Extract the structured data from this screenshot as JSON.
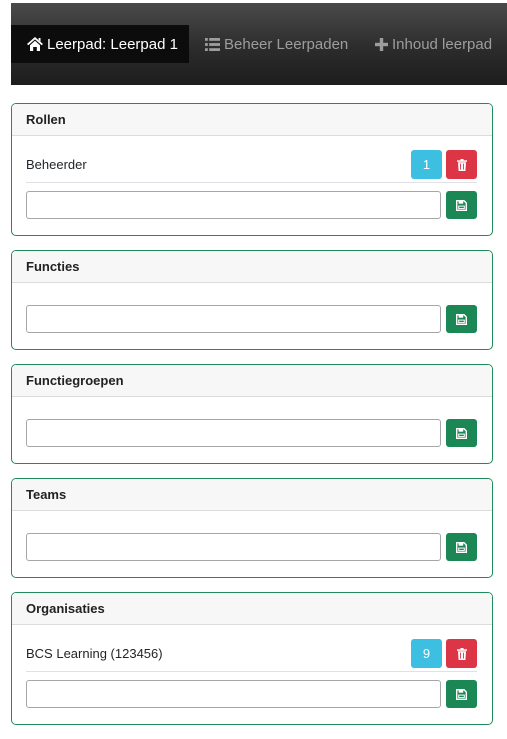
{
  "theme": {
    "panel_border": "#208b5d",
    "success": "#1a8754",
    "danger": "#dc3545",
    "info": "#3dbfe1",
    "navbar_active": "#0c0c0c"
  },
  "navbar": {
    "tabs": [
      {
        "icon": "home-icon",
        "label": "Leerpad: Leerpad 1",
        "active": true
      },
      {
        "icon": "list-icon",
        "label": "Beheer Leerpaden",
        "active": false
      },
      {
        "icon": "plus-icon",
        "label": "Inhoud leerpad",
        "active": false
      }
    ]
  },
  "panels": [
    {
      "title": "Rollen",
      "items": [
        {
          "label": "Beheerder",
          "count": "1"
        }
      ],
      "input_value": ""
    },
    {
      "title": "Functies",
      "items": [],
      "input_value": ""
    },
    {
      "title": "Functiegroepen",
      "items": [],
      "input_value": ""
    },
    {
      "title": "Teams",
      "items": [],
      "input_value": ""
    },
    {
      "title": "Organisaties",
      "items": [
        {
          "label": "BCS Learning (123456)",
          "count": "9"
        }
      ],
      "input_value": ""
    }
  ],
  "icons": {
    "delete": "trash-icon",
    "save": "save-icon"
  }
}
